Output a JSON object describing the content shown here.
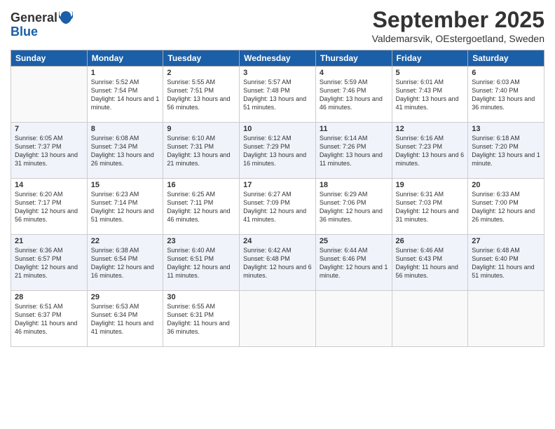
{
  "header": {
    "logo_general": "General",
    "logo_blue": "Blue",
    "month_year": "September 2025",
    "location": "Valdemarsvik, OEstergoetland, Sweden"
  },
  "days_of_week": [
    "Sunday",
    "Monday",
    "Tuesday",
    "Wednesday",
    "Thursday",
    "Friday",
    "Saturday"
  ],
  "weeks": [
    [
      {
        "day": "",
        "empty": true
      },
      {
        "day": "1",
        "sunrise": "Sunrise: 5:52 AM",
        "sunset": "Sunset: 7:54 PM",
        "daylight": "Daylight: 14 hours and 1 minute."
      },
      {
        "day": "2",
        "sunrise": "Sunrise: 5:55 AM",
        "sunset": "Sunset: 7:51 PM",
        "daylight": "Daylight: 13 hours and 56 minutes."
      },
      {
        "day": "3",
        "sunrise": "Sunrise: 5:57 AM",
        "sunset": "Sunset: 7:48 PM",
        "daylight": "Daylight: 13 hours and 51 minutes."
      },
      {
        "day": "4",
        "sunrise": "Sunrise: 5:59 AM",
        "sunset": "Sunset: 7:46 PM",
        "daylight": "Daylight: 13 hours and 46 minutes."
      },
      {
        "day": "5",
        "sunrise": "Sunrise: 6:01 AM",
        "sunset": "Sunset: 7:43 PM",
        "daylight": "Daylight: 13 hours and 41 minutes."
      },
      {
        "day": "6",
        "sunrise": "Sunrise: 6:03 AM",
        "sunset": "Sunset: 7:40 PM",
        "daylight": "Daylight: 13 hours and 36 minutes."
      }
    ],
    [
      {
        "day": "7",
        "sunrise": "Sunrise: 6:05 AM",
        "sunset": "Sunset: 7:37 PM",
        "daylight": "Daylight: 13 hours and 31 minutes."
      },
      {
        "day": "8",
        "sunrise": "Sunrise: 6:08 AM",
        "sunset": "Sunset: 7:34 PM",
        "daylight": "Daylight: 13 hours and 26 minutes."
      },
      {
        "day": "9",
        "sunrise": "Sunrise: 6:10 AM",
        "sunset": "Sunset: 7:31 PM",
        "daylight": "Daylight: 13 hours and 21 minutes."
      },
      {
        "day": "10",
        "sunrise": "Sunrise: 6:12 AM",
        "sunset": "Sunset: 7:29 PM",
        "daylight": "Daylight: 13 hours and 16 minutes."
      },
      {
        "day": "11",
        "sunrise": "Sunrise: 6:14 AM",
        "sunset": "Sunset: 7:26 PM",
        "daylight": "Daylight: 13 hours and 11 minutes."
      },
      {
        "day": "12",
        "sunrise": "Sunrise: 6:16 AM",
        "sunset": "Sunset: 7:23 PM",
        "daylight": "Daylight: 13 hours and 6 minutes."
      },
      {
        "day": "13",
        "sunrise": "Sunrise: 6:18 AM",
        "sunset": "Sunset: 7:20 PM",
        "daylight": "Daylight: 13 hours and 1 minute."
      }
    ],
    [
      {
        "day": "14",
        "sunrise": "Sunrise: 6:20 AM",
        "sunset": "Sunset: 7:17 PM",
        "daylight": "Daylight: 12 hours and 56 minutes."
      },
      {
        "day": "15",
        "sunrise": "Sunrise: 6:23 AM",
        "sunset": "Sunset: 7:14 PM",
        "daylight": "Daylight: 12 hours and 51 minutes."
      },
      {
        "day": "16",
        "sunrise": "Sunrise: 6:25 AM",
        "sunset": "Sunset: 7:11 PM",
        "daylight": "Daylight: 12 hours and 46 minutes."
      },
      {
        "day": "17",
        "sunrise": "Sunrise: 6:27 AM",
        "sunset": "Sunset: 7:09 PM",
        "daylight": "Daylight: 12 hours and 41 minutes."
      },
      {
        "day": "18",
        "sunrise": "Sunrise: 6:29 AM",
        "sunset": "Sunset: 7:06 PM",
        "daylight": "Daylight: 12 hours and 36 minutes."
      },
      {
        "day": "19",
        "sunrise": "Sunrise: 6:31 AM",
        "sunset": "Sunset: 7:03 PM",
        "daylight": "Daylight: 12 hours and 31 minutes."
      },
      {
        "day": "20",
        "sunrise": "Sunrise: 6:33 AM",
        "sunset": "Sunset: 7:00 PM",
        "daylight": "Daylight: 12 hours and 26 minutes."
      }
    ],
    [
      {
        "day": "21",
        "sunrise": "Sunrise: 6:36 AM",
        "sunset": "Sunset: 6:57 PM",
        "daylight": "Daylight: 12 hours and 21 minutes."
      },
      {
        "day": "22",
        "sunrise": "Sunrise: 6:38 AM",
        "sunset": "Sunset: 6:54 PM",
        "daylight": "Daylight: 12 hours and 16 minutes."
      },
      {
        "day": "23",
        "sunrise": "Sunrise: 6:40 AM",
        "sunset": "Sunset: 6:51 PM",
        "daylight": "Daylight: 12 hours and 11 minutes."
      },
      {
        "day": "24",
        "sunrise": "Sunrise: 6:42 AM",
        "sunset": "Sunset: 6:48 PM",
        "daylight": "Daylight: 12 hours and 6 minutes."
      },
      {
        "day": "25",
        "sunrise": "Sunrise: 6:44 AM",
        "sunset": "Sunset: 6:46 PM",
        "daylight": "Daylight: 12 hours and 1 minute."
      },
      {
        "day": "26",
        "sunrise": "Sunrise: 6:46 AM",
        "sunset": "Sunset: 6:43 PM",
        "daylight": "Daylight: 11 hours and 56 minutes."
      },
      {
        "day": "27",
        "sunrise": "Sunrise: 6:48 AM",
        "sunset": "Sunset: 6:40 PM",
        "daylight": "Daylight: 11 hours and 51 minutes."
      }
    ],
    [
      {
        "day": "28",
        "sunrise": "Sunrise: 6:51 AM",
        "sunset": "Sunset: 6:37 PM",
        "daylight": "Daylight: 11 hours and 46 minutes."
      },
      {
        "day": "29",
        "sunrise": "Sunrise: 6:53 AM",
        "sunset": "Sunset: 6:34 PM",
        "daylight": "Daylight: 11 hours and 41 minutes."
      },
      {
        "day": "30",
        "sunrise": "Sunrise: 6:55 AM",
        "sunset": "Sunset: 6:31 PM",
        "daylight": "Daylight: 11 hours and 36 minutes."
      },
      {
        "day": "",
        "empty": true
      },
      {
        "day": "",
        "empty": true
      },
      {
        "day": "",
        "empty": true
      },
      {
        "day": "",
        "empty": true
      }
    ]
  ]
}
